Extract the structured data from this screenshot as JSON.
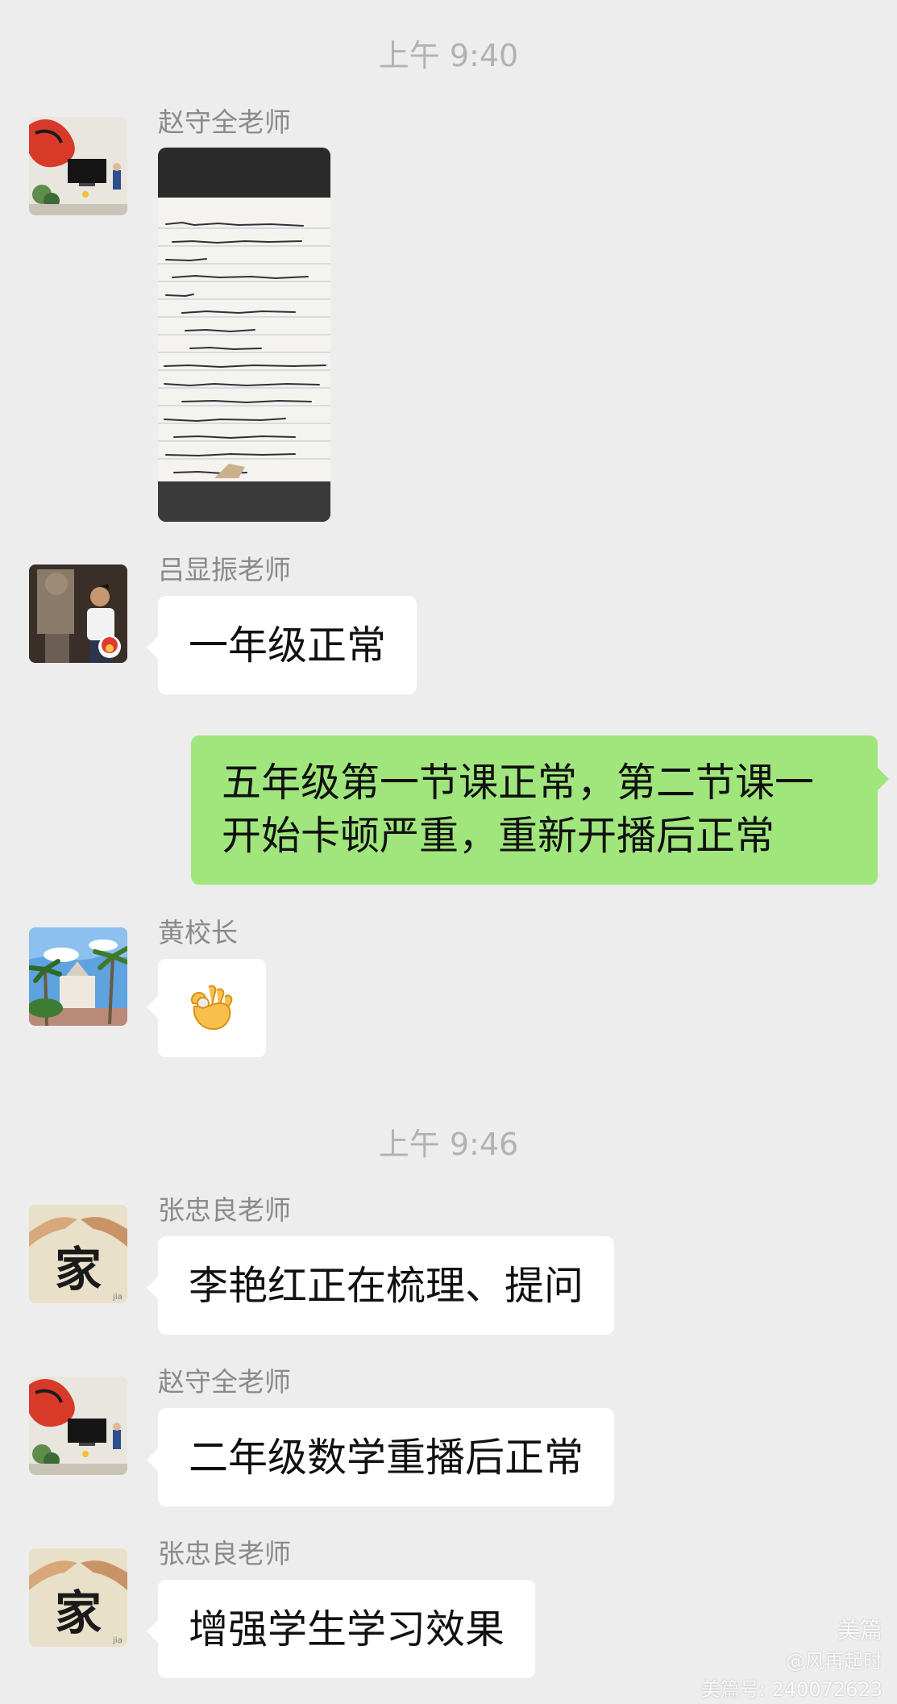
{
  "timestamps": [
    "上午 9:40",
    "上午 9:46"
  ],
  "messages": [
    {
      "sender": "赵守全老师",
      "kind": "image"
    },
    {
      "sender": "吕显振老师",
      "text": "一年级正常"
    },
    {
      "sender": "",
      "text": "五年级第一节课正常，第二节课一开始卡顿严重，重新开播后正常",
      "outgoing": true
    },
    {
      "sender": "黄校长",
      "kind": "emoji",
      "emoji": "ok-hand-emoji"
    },
    {
      "sender": "张忠良老师",
      "text": "李艳红正在梳理、提问"
    },
    {
      "sender": "赵守全老师",
      "text": "二年级数学重播后正常"
    },
    {
      "sender": "张忠良老师",
      "text": "增强学生学习效果"
    }
  ],
  "avatar_glyphs": {
    "zhang": "家",
    "zhang_small": "jia"
  },
  "watermark": {
    "brand": "美篇",
    "author": "@风再起时",
    "id": "美篇号: 240072623"
  },
  "colors": {
    "background": "#ededed",
    "outgoing_bubble": "#a0e67c",
    "incoming_bubble": "#ffffff",
    "timestamp": "#b2b2b2"
  }
}
